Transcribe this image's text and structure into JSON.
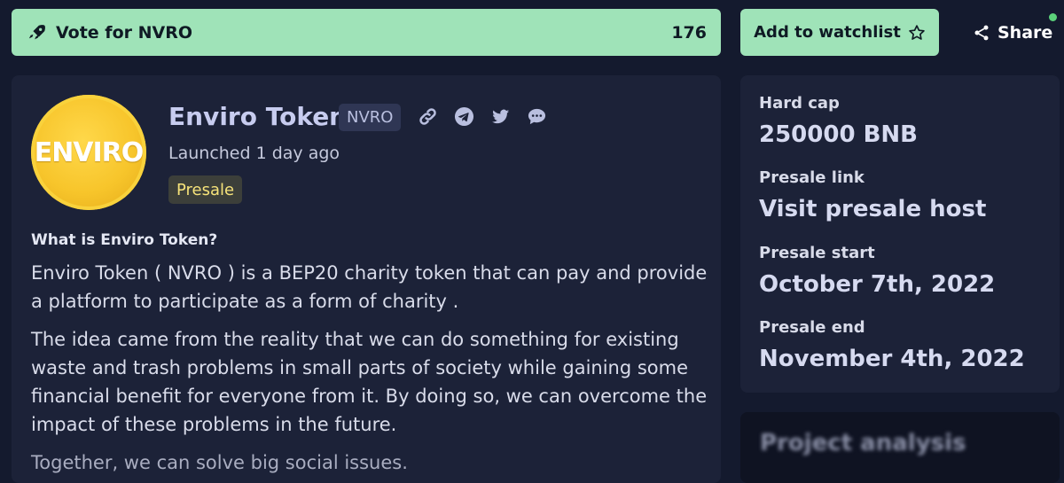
{
  "vote": {
    "label": "Vote for NVRO",
    "count": "176",
    "icon": "rocket-icon"
  },
  "watchlist": {
    "label": "Add to watchlist",
    "icon": "star-outline-icon"
  },
  "share": {
    "label": "Share",
    "icon": "share-icon"
  },
  "token": {
    "logo_text": "ENVIRO",
    "name": "Enviro Token",
    "ticker": "NVRO",
    "launched": "Launched 1 day ago",
    "status": "Presale",
    "links": [
      "link-icon",
      "telegram-icon",
      "twitter-icon",
      "chat-icon"
    ]
  },
  "description": {
    "title": "What is Enviro Token?",
    "paragraphs": [
      "Enviro Token ( NVRO ) is a BEP20 charity token that can pay and provide a platform to participate as a form of charity .",
      "The idea came from the reality that we can do something for existing waste and trash problems in small parts of society while gaining some financial benefit for everyone from it. By doing so, we can overcome the impact of these problems in the future.",
      "Together, we can solve big social issues."
    ]
  },
  "presale": {
    "hard_cap_label": "Hard cap",
    "hard_cap_value": "250000 BNB",
    "link_label": "Presale link",
    "link_value": "Visit presale host",
    "start_label": "Presale start",
    "start_value": "October 7th, 2022",
    "end_label": "Presale end",
    "end_value": "November 4th, 2022"
  },
  "analysis": {
    "title": "Project analysis"
  },
  "colors": {
    "page_bg": "#141a2e",
    "card_bg": "#1c2238",
    "accent_green": "#9fe3b8",
    "badge_text": "#f5e27a",
    "notification": "#5bd17a"
  }
}
